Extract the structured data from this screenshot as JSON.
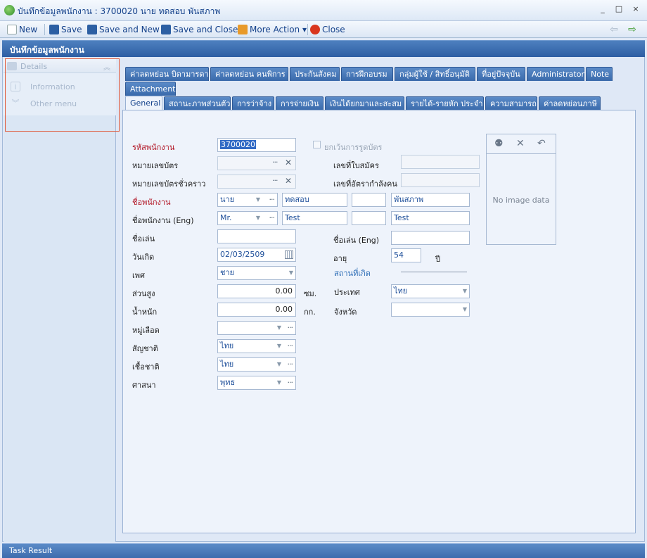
{
  "window": {
    "title": "บันทึกข้อมูลพนักงาน : 3700020 นาย ทดสอบ พันสภาพ",
    "controls": [
      "_",
      "□",
      "×"
    ]
  },
  "toolbar": {
    "new_label": "New",
    "save_label": "Save",
    "save_new_label": "Save and New",
    "save_close_label": "Save and Close",
    "more_action_label": "More Action ▾",
    "close_label": "Close"
  },
  "header": {
    "title": "บันทึกข้อมูลพนักงาน"
  },
  "sidebar": {
    "details_label": "Details",
    "items": [
      {
        "label": "Information"
      },
      {
        "label": "Other menu"
      }
    ]
  },
  "tabs_row1": [
    "ค่าลดหย่อน บิดามารดา",
    "ค่าลดหย่อน คนพิการ",
    "ประกันสังคม",
    "การฝึกอบรม",
    "กลุ่มผู้ใช้ / สิทธิ์อนุมัติ",
    "ที่อยู่ปัจจุบัน",
    "Administrator",
    "Note"
  ],
  "tabs_row2": [
    "Attachment"
  ],
  "tabs_row3": [
    "General",
    "สถานะภาพส่วนตัว",
    "การว่าจ้าง",
    "การจ่ายเงิน",
    "เงินได้ยกมาและสะสม",
    "รายได้-รายหัก ประจำ",
    "ความสามารถ",
    "ค่าลดหย่อนภาษี"
  ],
  "form": {
    "emp_code_label": "รหัสพนักงาน",
    "emp_code_value": "3700020",
    "exempt_scan_label": "ยกเว้นการรูดบัตร",
    "card_no_label": "หมายเลขบัตร",
    "application_no_label": "เลขที่ใบสมัคร",
    "temp_card_label": "หมายเลขบัตรชั่วคราว",
    "manpower_no_label": "เลขที่อัตรากำลังคน",
    "name_label": "ชื่อพนักงาน",
    "prefix_th": "นาย",
    "first_name_th": "ทดสอบ",
    "last_name_th": "พันสภาพ",
    "name_en_label": "ชื่อพนักงาน (Eng)",
    "prefix_en": "Mr.",
    "first_name_en": "Test",
    "last_name_en": "Test",
    "nickname_label": "ชื่อเล่น",
    "nickname_en_label": "ชื่อเล่น (Eng)",
    "birthdate_label": "วันเกิด",
    "birthdate_value": "02/03/2509",
    "age_label": "อายุ",
    "age_value": "54",
    "age_unit": "ปี",
    "gender_label": "เพศ",
    "gender_value": "ชาย",
    "birthplace_label": "สถานที่เกิด",
    "height_label": "ส่วนสูง",
    "height_value": "0.00",
    "height_unit": "ซม.",
    "country_label": "ประเทศ",
    "country_value": "ไทย",
    "weight_label": "น้ำหนัก",
    "weight_value": "0.00",
    "weight_unit": "กก.",
    "province_label": "จังหวัด",
    "blood_label": "หมู่เลือด",
    "nationality_label": "สัญชาติ",
    "nationality_value": "ไทย",
    "race_label": "เชื้อชาติ",
    "race_value": "ไทย",
    "religion_label": "ศาสนา",
    "religion_value": "พุทธ"
  },
  "photo": {
    "no_image_text": "No image data"
  },
  "task_result_label": "Task Result"
}
